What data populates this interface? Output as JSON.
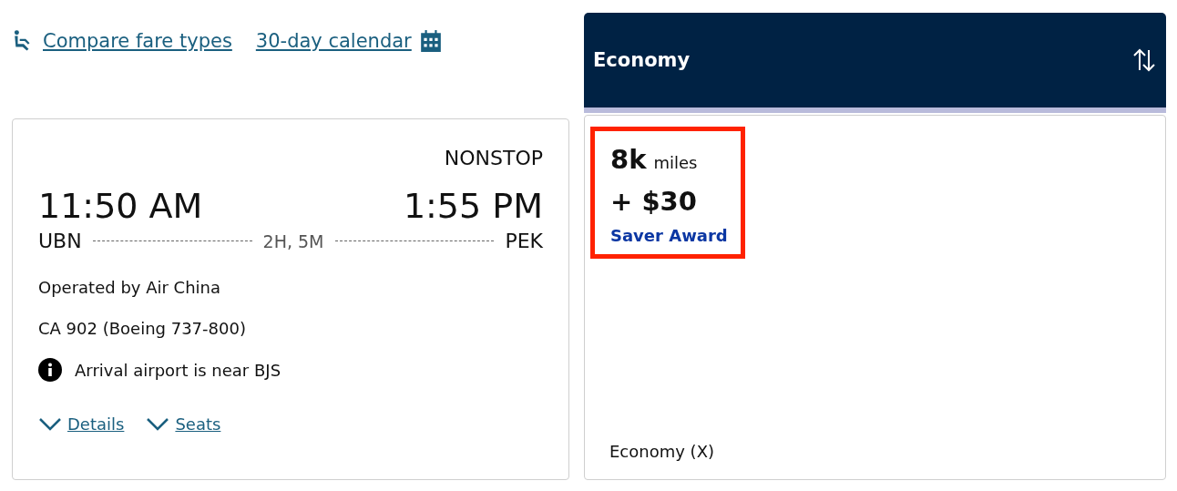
{
  "top_links": [
    {
      "kind": "seat",
      "label": "Compare fare types"
    },
    {
      "kind": "calendar",
      "label": "30-day calendar"
    }
  ],
  "flight": {
    "stops": "NONSTOP",
    "departure_time": "11:50 AM",
    "arrival_time": "1:55 PM",
    "origin": "UBN",
    "duration": "2H, 5M",
    "destination": "PEK",
    "operator": "Operated by Air China",
    "flight_number": "CA 902 (Boeing 737-800)",
    "notice": "Arrival airport is near BJS",
    "toggles": [
      {
        "label": "Details",
        "expanded": false
      },
      {
        "label": "Seats",
        "expanded": false
      }
    ]
  },
  "cabin_header": {
    "title": "Economy"
  },
  "fare": {
    "highlighted": true,
    "miles": "8k",
    "miles_unit": "miles",
    "cash": "+ $30",
    "award_type": "Saver Award",
    "fare_class": "Economy (X)"
  }
}
